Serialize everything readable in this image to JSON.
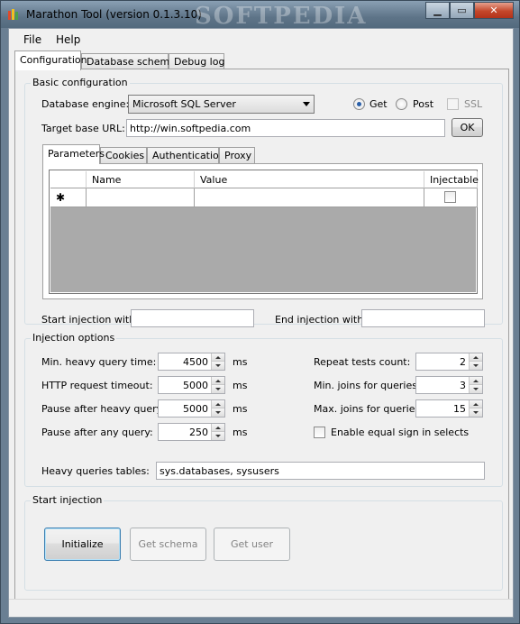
{
  "window": {
    "title": "Marathon Tool  (version 0.1.3.10)",
    "watermark": "SOFTPEDIA",
    "minimize_icon": "minimize-icon",
    "maximize_icon": "maximize-icon",
    "close_icon": "close-icon"
  },
  "menu": {
    "file": "File",
    "help": "Help"
  },
  "tabs": {
    "configuration": "Configuration",
    "database_schema": "Database schema",
    "debug_log": "Debug log"
  },
  "basic": {
    "group_label": "Basic configuration",
    "engine_label": "Database engine:",
    "engine_value": "Microsoft SQL Server",
    "get_label": "Get",
    "post_label": "Post",
    "ssl_label": "SSL",
    "method_selected": "Get",
    "url_label": "Target base URL:",
    "url_value": "http://win.softpedia.com",
    "ok_label": "OK",
    "subtabs": {
      "parameters": "Parameters",
      "cookies": "Cookies",
      "authentication": "Authentication",
      "proxy": "Proxy"
    },
    "grid": {
      "columns": [
        "Name",
        "Value",
        "Injectable"
      ],
      "new_row_marker": "✱"
    },
    "start_injection_label": "Start injection with:",
    "start_injection_value": "",
    "end_injection_label": "End injection with:",
    "end_injection_value": ""
  },
  "injection": {
    "group_label": "Injection options",
    "min_heavy_label": "Min. heavy query time:",
    "min_heavy_value": "4500",
    "http_timeout_label": "HTTP request timeout:",
    "http_timeout_value": "5000",
    "pause_heavy_label": "Pause after heavy query:",
    "pause_heavy_value": "5000",
    "pause_any_label": "Pause after any query:",
    "pause_any_value": "250",
    "unit_ms": "ms",
    "repeat_label": "Repeat tests count:",
    "repeat_value": "2",
    "min_joins_label": "Min. joins for queries:",
    "min_joins_value": "3",
    "max_joins_label": "Max. joins for queries:",
    "max_joins_value": "15",
    "equal_sign_label": "Enable equal sign in selects",
    "equal_sign_checked": false,
    "heavy_tables_label": "Heavy queries tables:",
    "heavy_tables_value": "sys.databases, sysusers"
  },
  "start": {
    "group_label": "Start injection",
    "initialize_label": "Initialize",
    "get_schema_label": "Get schema",
    "get_user_label": "Get user"
  },
  "colors": {
    "titlebar": "#5e7488",
    "accent": "#3c7fb1",
    "grid_empty": "#aaaaaa"
  }
}
